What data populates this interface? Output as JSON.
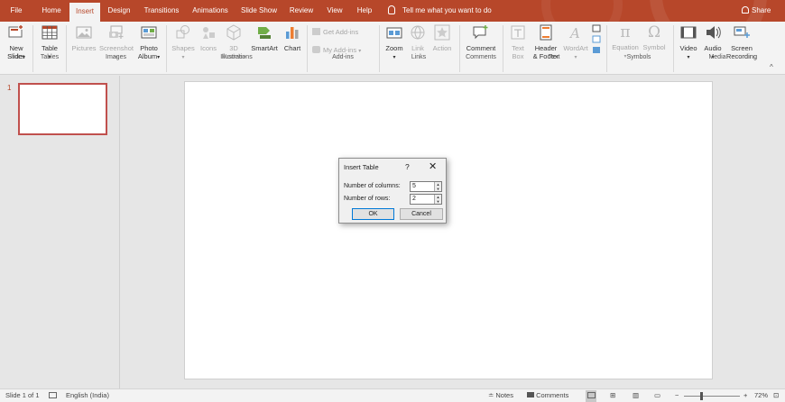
{
  "tabs": [
    "File",
    "Home",
    "Insert",
    "Design",
    "Transitions",
    "Animations",
    "Slide Show",
    "Review",
    "View",
    "Help"
  ],
  "active_tab": "Insert",
  "tell_me": "Tell me what you want to do",
  "share": "Share",
  "ribbon": {
    "slides": {
      "new_slide_1": "New",
      "new_slide_2": "Slide",
      "group": "Slides"
    },
    "tables": {
      "table": "Table",
      "group": "Tables"
    },
    "images": {
      "pictures": "Pictures",
      "screenshot": "Screenshot",
      "photo_album_1": "Photo",
      "photo_album_2": "Album",
      "group": "Images"
    },
    "illustrations": {
      "shapes": "Shapes",
      "icons": "Icons",
      "models_1": "3D",
      "models_2": "Models",
      "smartart": "SmartArt",
      "chart": "Chart",
      "group": "Illustrations"
    },
    "addins": {
      "get_addins": "Get Add-ins",
      "my_addins": "My Add-ins",
      "group": "Add-ins"
    },
    "links": {
      "zoom": "Zoom",
      "link": "Link",
      "action": "Action",
      "group": "Links"
    },
    "comments": {
      "comment": "Comment",
      "group": "Comments"
    },
    "text": {
      "textbox_1": "Text",
      "textbox_2": "Box",
      "header_1": "Header",
      "header_2": "& Footer",
      "wordart": "WordArt",
      "group": "Text"
    },
    "symbols": {
      "equation": "Equation",
      "symbol": "Symbol",
      "group": "Symbols"
    },
    "media": {
      "video": "Video",
      "audio": "Audio",
      "screen_1": "Screen",
      "screen_2": "Recording",
      "group": "Media"
    }
  },
  "thumbnail": {
    "number": "1"
  },
  "dialog": {
    "title": "Insert Table",
    "help": "?",
    "close": "✕",
    "columns_label": "Number of columns:",
    "columns_value": "5",
    "rows_label": "Number of rows:",
    "rows_value": "2",
    "ok": "OK",
    "cancel": "Cancel"
  },
  "status": {
    "slide": "Slide 1 of 1",
    "language": "English (India)",
    "notes": "Notes",
    "comments": "Comments",
    "zoom": "72%"
  },
  "colors": {
    "accent": "#b7472a",
    "ribbon": "#f3f3f3",
    "canvas": "#e6e6e6"
  }
}
